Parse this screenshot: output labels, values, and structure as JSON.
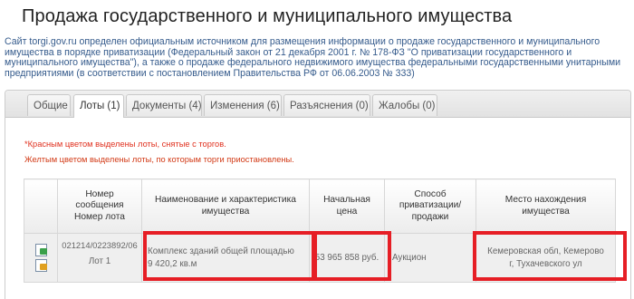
{
  "page": {
    "title": "Продажа государственного и муниципального имущества",
    "intro": "Сайт torgi.gov.ru определен официальным источником для размещения информации о продаже государственного и муниципального имущества в порядке приватизации (Федеральный закон от 21 декабря 2001 г. № 178-ФЗ \"О приватизации государственного и муниципального имущества\"), а также о продаже федерального недвижимого имущества федеральными государственными унитарными предприятиями (в соответствии с постановлением Правительства РФ от 06.06.2003 № 333)"
  },
  "tabs": [
    {
      "label": "Общие"
    },
    {
      "label": "Лоты (1)"
    },
    {
      "label": "Документы (4)"
    },
    {
      "label": "Изменения (6)"
    },
    {
      "label": "Разъяснения (0)"
    },
    {
      "label": "Жалобы (0)"
    }
  ],
  "notes": {
    "red": "*Красным цветом выделены лоты, снятые с торгов.",
    "yellow": "Желтым цветом выделены лоты, по которым торги приостановлены."
  },
  "table": {
    "headers": {
      "number_line1": "Номер",
      "number_line2": "сообщения",
      "number_line3": "Номер лота",
      "name_line1": "Наименование и характеристика",
      "name_line2": "имущества",
      "price_line1": "Начальная",
      "price_line2": "цена",
      "method_line1": "Способ",
      "method_line2": "приватизации/",
      "method_line3": "продажи",
      "place_line1": "Место нахождения",
      "place_line2": "имущества"
    },
    "row": {
      "message_number": "021214/0223892/06",
      "lot_number": "Лот 1",
      "name": "Комплекс зданий общей площадью 9 420,2 кв.м",
      "price": "53 965 858 руб.",
      "method": "Аукцион",
      "place": "Кемеровская обл, Кемерово г, Тухачевского ул"
    }
  },
  "colors": {
    "highlight": "#e61e25",
    "link": "#355b8c",
    "removed_note": "#e0301e"
  }
}
